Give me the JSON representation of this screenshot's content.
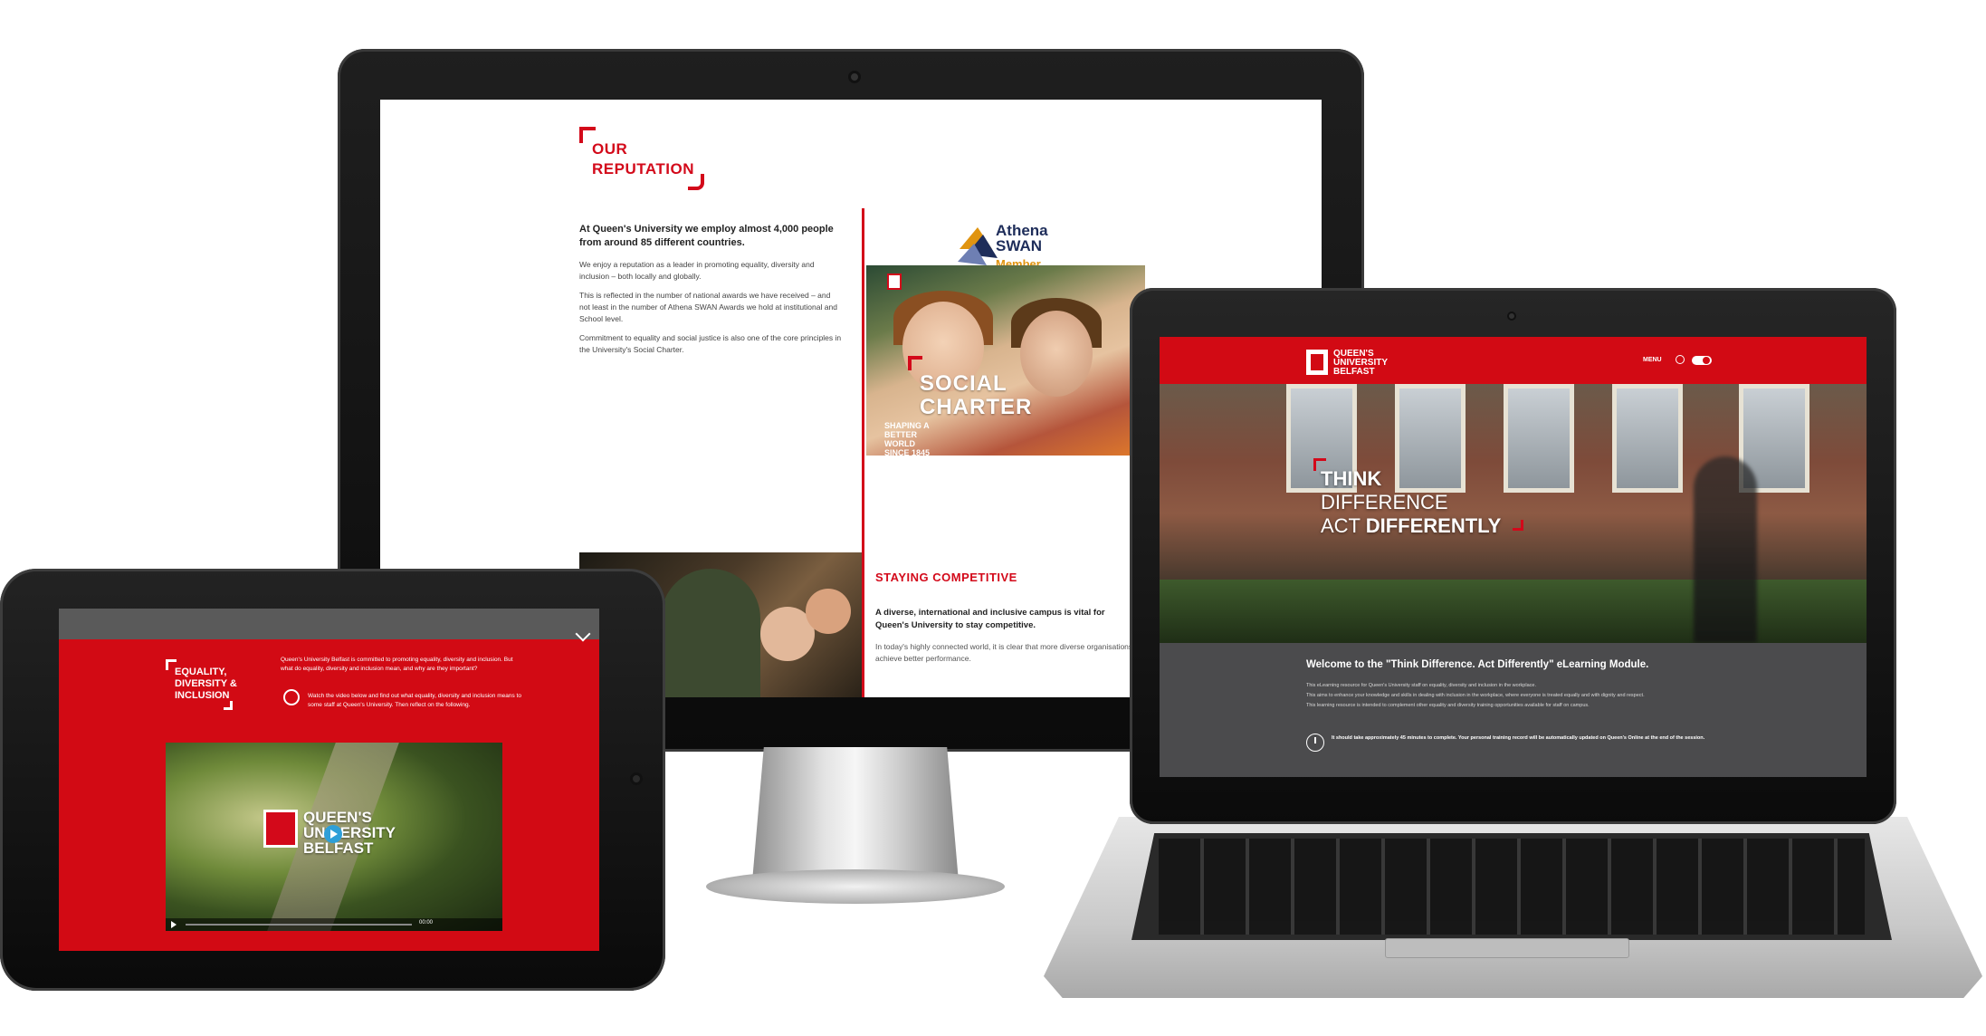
{
  "monitor": {
    "reputation_title": "OUR REPUTATION",
    "reputation_lead": "At Queen's University we employ almost 4,000 people from around 85 different countries.",
    "reputation_p1": "We enjoy a reputation as a leader in promoting equality, diversity and inclusion – both locally and globally.",
    "reputation_p2": "This is reflected in the number of national awards we have received – and not least in the number of Athena SWAN Awards we hold at institutional and School level.",
    "reputation_p3": "Commitment to equality and social justice is also one of the core principles in the University's Social Charter.",
    "athena_name": "Athena SWAN",
    "athena_member": "Member",
    "social_title": "SOCIAL CHARTER",
    "social_sub": "SHAPING A BETTER WORLD SINCE 1845",
    "staying_title": "STAYING COMPETITIVE",
    "staying_lead": "A diverse, international and inclusive campus is vital for Queen's University to stay competitive.",
    "staying_body": "In today's highly connected world, it is clear that more diverse organisations achieve better performance."
  },
  "tablet": {
    "heading": "EQUALITY, DIVERSITY & INCLUSION",
    "intro": "Queen's University Belfast is committed to promoting equality, diversity and inclusion. But what do equality, diversity and inclusion mean, and why are they important?",
    "watch": "Watch the video below and find out what equality, diversity and inclusion means to some staff at Queen's University. Then reflect on the following.",
    "video_brand": "QUEEN'S UNIVERSITY BELFAST",
    "video_time": "00:00"
  },
  "laptop": {
    "brand": "QUEEN'S UNIVERSITY BELFAST",
    "menu_label": "MENU",
    "hero_line1": "THINK",
    "hero_line2": "DIFFERENCE",
    "hero_line3_a": "ACT ",
    "hero_line3_b": "DIFFERENTLY",
    "welcome": "Welcome to the \"Think Difference. Act Differently\" eLearning Module.",
    "line1": "This eLearning resource for Queen's University staff on equality, diversity and inclusion in the workplace.",
    "line2": "This aims to enhance your knowledge and skills in dealing with inclusion in the workplace, where everyone is treated equally and with dignity and respect.",
    "line3": "This learning resource is intended to complement other equality and diversity training opportunities available for staff on campus.",
    "duration": "It should take approximately 45 minutes to complete. Your personal training record will be automatically updated on Queen's Online at the end of the session."
  },
  "colors": {
    "brand_red": "#d20a14",
    "athena_navy": "#1e2d5a",
    "athena_orange": "#e09410"
  }
}
